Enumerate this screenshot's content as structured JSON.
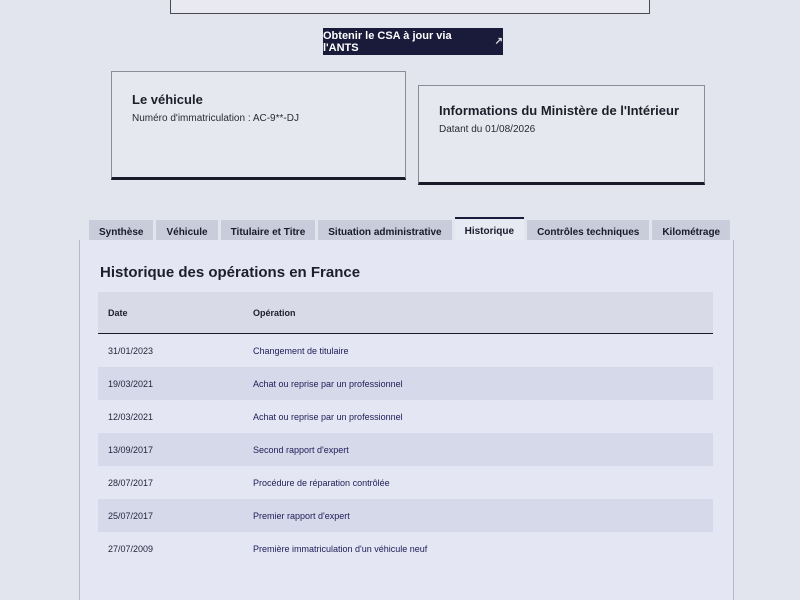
{
  "ants_button": {
    "label": "Obtenir le CSA à jour via l'ANTS",
    "icon": "external-link-icon"
  },
  "vehicle_card": {
    "title": "Le véhicule",
    "plate_label": "Numéro d'immatriculation : AC-9**-DJ"
  },
  "ministry_card": {
    "title": "Informations du Ministère de l'Intérieur",
    "date_label": "Datant du 01/08/2026"
  },
  "tabs": [
    {
      "label": "Synthèse",
      "active": false
    },
    {
      "label": "Véhicule",
      "active": false
    },
    {
      "label": "Titulaire et Titre",
      "active": false
    },
    {
      "label": "Situation administrative",
      "active": false
    },
    {
      "label": "Historique",
      "active": true
    },
    {
      "label": "Contrôles techniques",
      "active": false
    },
    {
      "label": "Kilométrage",
      "active": false
    }
  ],
  "history": {
    "title": "Historique des opérations en France",
    "columns": {
      "date": "Date",
      "operation": "Opération"
    },
    "rows": [
      {
        "date": "31/01/2023",
        "operation": "Changement de titulaire"
      },
      {
        "date": "19/03/2021",
        "operation": "Achat ou reprise par un professionnel"
      },
      {
        "date": "12/03/2021",
        "operation": "Achat ou reprise par un professionnel"
      },
      {
        "date": "13/09/2017",
        "operation": "Second rapport d'expert"
      },
      {
        "date": "28/07/2017",
        "operation": "Procédure de réparation contrôlée"
      },
      {
        "date": "25/07/2017",
        "operation": "Premier rapport d'expert"
      },
      {
        "date": "27/07/2009",
        "operation": "Première immatriculation d'un véhicule neuf"
      }
    ]
  }
}
